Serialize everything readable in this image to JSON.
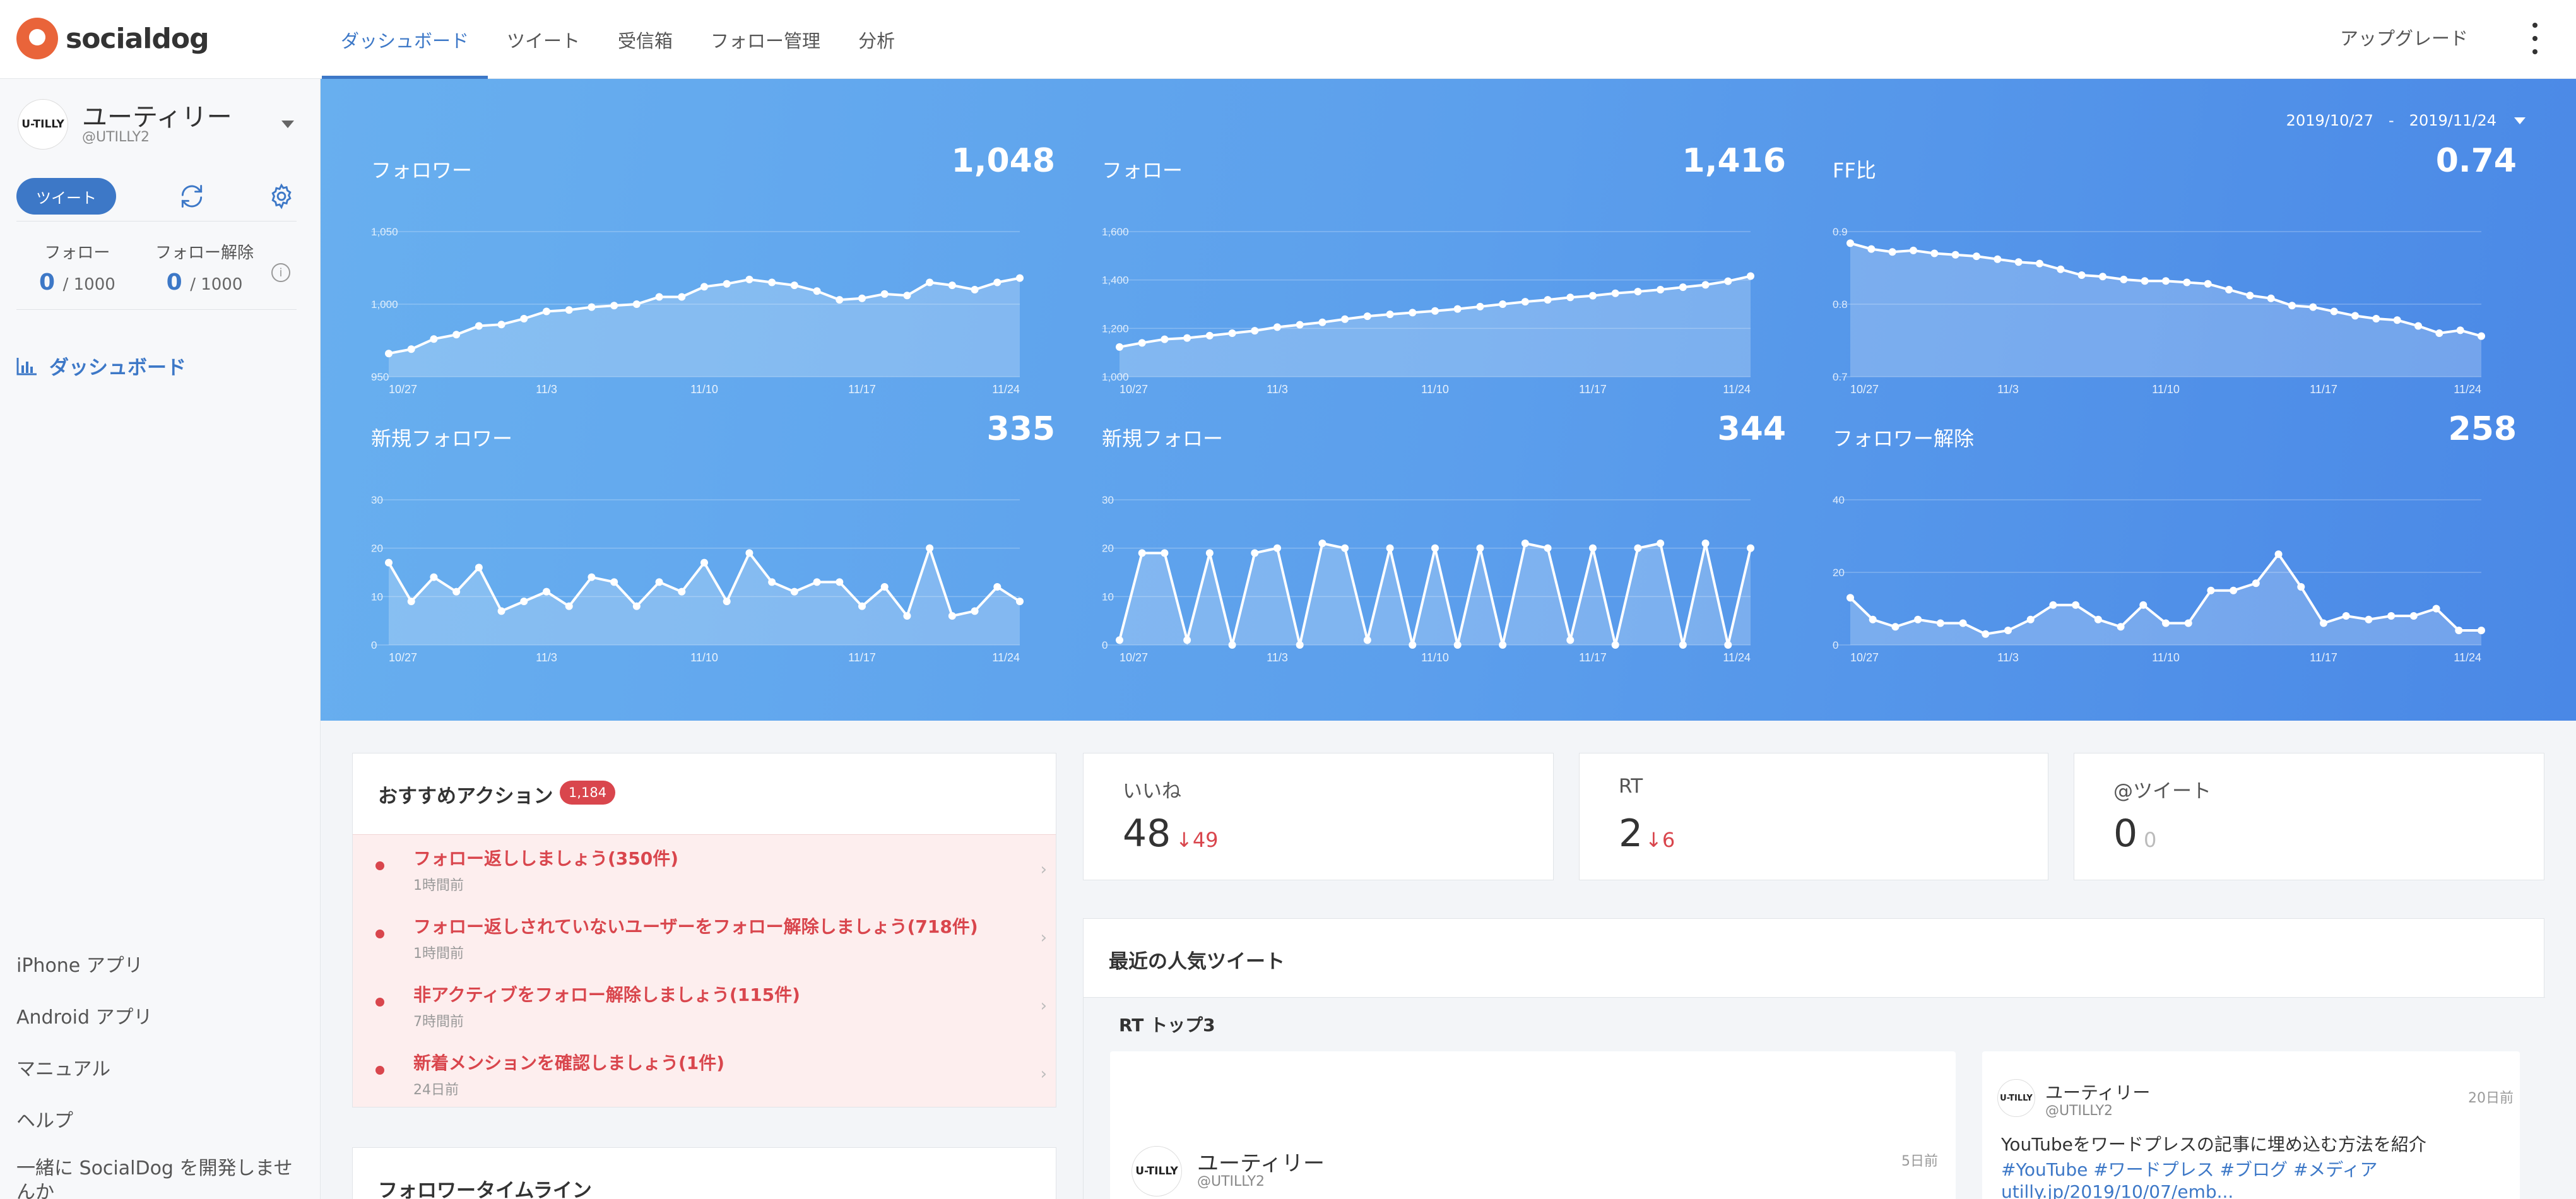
{
  "app": {
    "logo_text": "socialdog"
  },
  "nav": {
    "tabs": [
      {
        "label": "ダッシュボード",
        "active": true
      },
      {
        "label": "ツイート"
      },
      {
        "label": "受信箱"
      },
      {
        "label": "フォロー管理"
      },
      {
        "label": "分析"
      }
    ],
    "upgrade_label": "アップグレード"
  },
  "account": {
    "avatar_text": "U-TILLY",
    "name": "ユーティリー",
    "handle": "@UTILLY2"
  },
  "sidebar": {
    "tweet_button": "ツイート",
    "quota": {
      "follow_label": "フォロー",
      "follow_used": "0",
      "follow_limit": "/ 1000",
      "unfollow_label": "フォロー解除",
      "unfollow_used": "0",
      "unfollow_limit": "/ 1000"
    },
    "info_symbol": "i",
    "dashboard_label": "ダッシュボード",
    "links": [
      "iPhone アプリ",
      "Android アプリ",
      "マニュアル",
      "ヘルプ",
      "一緒に SocialDog を開発しませんか"
    ]
  },
  "hero": {
    "date_from": "2019/10/27",
    "date_sep": "-",
    "date_to": "2019/11/24",
    "accent": "#5c9fec"
  },
  "chart_data": [
    {
      "type": "area",
      "title": "フォロワー",
      "value": "1,048",
      "ylim": [
        950,
        1050
      ],
      "yticks": [
        "1,050",
        "1,000",
        "950"
      ],
      "xticks": [
        "10/27",
        "11/3",
        "11/10",
        "11/17",
        "11/24"
      ],
      "values": [
        966,
        969,
        976,
        979,
        985,
        986,
        990,
        995,
        996,
        998,
        999,
        1000,
        1005,
        1005,
        1012,
        1014,
        1017,
        1015,
        1013,
        1009,
        1003,
        1004,
        1007,
        1006,
        1015,
        1013,
        1010,
        1015,
        1018
      ]
    },
    {
      "type": "area",
      "title": "フォロー",
      "value": "1,416",
      "ylim": [
        1000,
        1600
      ],
      "yticks": [
        "1,600",
        "1,400",
        "1,200",
        "1,000"
      ],
      "xticks": [
        "10/27",
        "11/3",
        "11/10",
        "11/17",
        "11/24"
      ],
      "values": [
        1123,
        1140,
        1155,
        1160,
        1170,
        1180,
        1190,
        1205,
        1215,
        1225,
        1238,
        1250,
        1258,
        1265,
        1272,
        1280,
        1290,
        1300,
        1310,
        1318,
        1328,
        1335,
        1345,
        1352,
        1360,
        1370,
        1380,
        1395,
        1416
      ]
    },
    {
      "type": "area",
      "title": "FF比",
      "value": "0.74",
      "ylim": [
        0.7,
        0.9
      ],
      "yticks": [
        "0.9",
        "0.8",
        "0.7"
      ],
      "xticks": [
        "10/27",
        "11/3",
        "11/10",
        "11/17",
        "11/24"
      ],
      "values": [
        0.884,
        0.876,
        0.872,
        0.874,
        0.87,
        0.868,
        0.866,
        0.862,
        0.858,
        0.856,
        0.848,
        0.84,
        0.838,
        0.834,
        0.832,
        0.832,
        0.83,
        0.828,
        0.82,
        0.812,
        0.808,
        0.798,
        0.796,
        0.79,
        0.784,
        0.78,
        0.778,
        0.77,
        0.76,
        0.764,
        0.756
      ]
    },
    {
      "type": "line",
      "title": "新規フォロワー",
      "value": "335",
      "ylim": [
        0,
        30
      ],
      "yticks": [
        "30",
        "20",
        "10",
        "0"
      ],
      "xticks": [
        "10/27",
        "11/3",
        "11/10",
        "11/17",
        "11/24"
      ],
      "values": [
        17,
        9,
        14,
        11,
        16,
        7,
        9,
        11,
        8,
        14,
        13,
        8,
        13,
        11,
        17,
        9,
        19,
        13,
        11,
        13,
        13,
        8,
        12,
        6,
        20,
        6,
        7,
        12,
        9
      ]
    },
    {
      "type": "line",
      "title": "新規フォロー",
      "value": "344",
      "ylim": [
        0,
        30
      ],
      "yticks": [
        "30",
        "20",
        "10",
        "0"
      ],
      "xticks": [
        "10/27",
        "11/3",
        "11/10",
        "11/17",
        "11/24"
      ],
      "values": [
        1,
        19,
        19,
        1,
        19,
        0,
        19,
        20,
        0,
        21,
        20,
        1,
        20,
        0,
        20,
        0,
        20,
        0,
        21,
        20,
        1,
        20,
        0,
        20,
        21,
        0,
        21,
        0,
        20
      ]
    },
    {
      "type": "line",
      "title": "フォロワー解除",
      "value": "258",
      "ylim": [
        0,
        40
      ],
      "yticks": [
        "40",
        "20",
        "0"
      ],
      "xticks": [
        "10/27",
        "11/3",
        "11/10",
        "11/17",
        "11/24"
      ],
      "values": [
        13,
        7,
        5,
        7,
        6,
        6,
        3,
        4,
        7,
        11,
        11,
        7,
        5,
        11,
        6,
        6,
        15,
        15,
        17,
        25,
        16,
        6,
        8,
        7,
        8,
        8,
        10,
        4,
        4
      ]
    }
  ],
  "recommended": {
    "title": "おすすめアクション",
    "badge": "1,184",
    "items": [
      {
        "text": "フォロー返ししましょう(350件)",
        "time": "1時間前"
      },
      {
        "text": "フォロー返しされていないユーザーをフォロー解除しましょう(718件)",
        "time": "1時間前"
      },
      {
        "text": "非アクティブをフォロー解除しましょう(115件)",
        "time": "7時間前"
      },
      {
        "text": "新着メンションを確認しましょう(1件)",
        "time": "24日前"
      }
    ],
    "chevron": "›",
    "accent": "#d9464d"
  },
  "follower_timeline": {
    "title": "フォロワータイムライン"
  },
  "metrics": [
    {
      "label": "いいね",
      "value": "48",
      "delta": "↓49",
      "delta_color": "#d9464d"
    },
    {
      "label": "RT",
      "value": "2",
      "delta": "↓6",
      "delta_color": "#d9464d"
    },
    {
      "label": "@ツイート",
      "value": "0",
      "delta": "0",
      "delta_color": "#bbbbbb"
    }
  ],
  "popular": {
    "title": "最近の人気ツイート",
    "subtitle": "RT トップ3",
    "tweets": [
      {
        "avatar_text": "U-TILLY",
        "name": "ユーティリー",
        "handle": "@UTILLY2",
        "time": "5日前"
      },
      {
        "avatar_text": "U-TILLY",
        "name": "ユーティリー",
        "handle": "@UTILLY2",
        "time": "20日前",
        "text": "YouTubeをワードプレスの記事に埋め込む方法を紹介",
        "tags": "#YouTube #ワードプレス #ブログ #メディア",
        "link": "utilly.jp/2019/10/07/emb..."
      }
    ]
  },
  "icons": {
    "refresh": "refresh-icon",
    "settings": "gear-icon",
    "chart": "bar-chart-icon",
    "more": "kebab-menu-icon"
  }
}
